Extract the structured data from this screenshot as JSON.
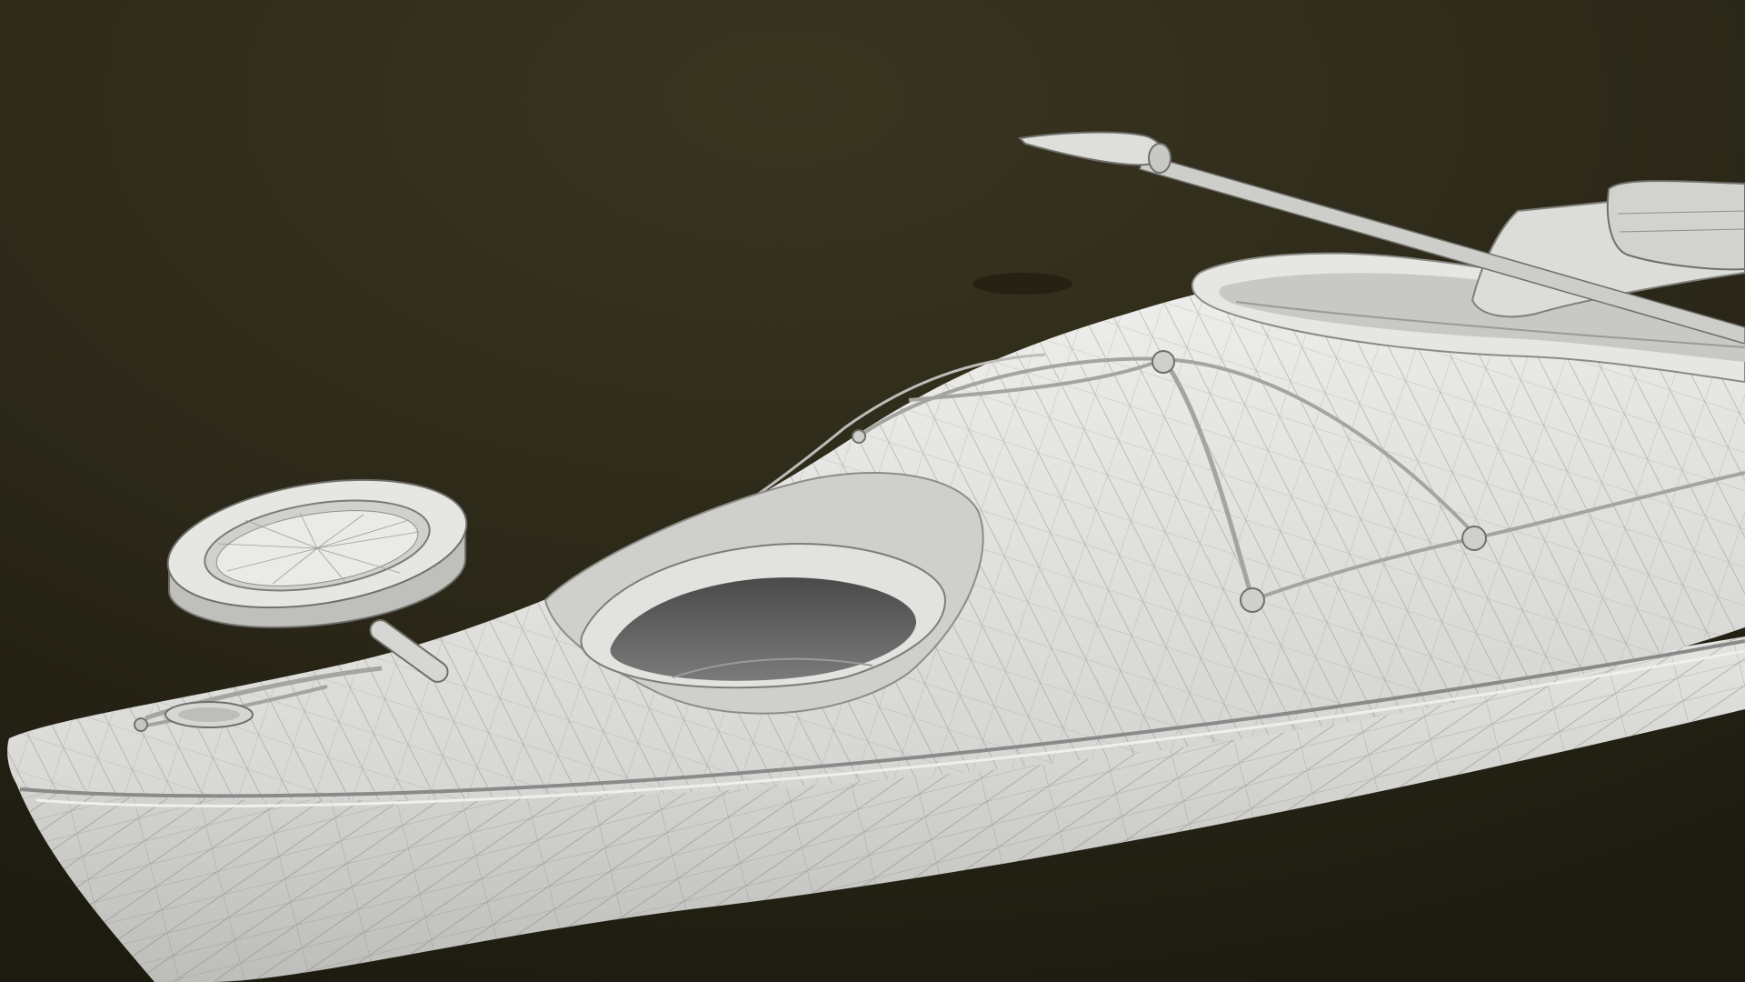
{
  "scene": {
    "subject": "kayak-wireframe-render",
    "colors": {
      "background_top": "#3a3521",
      "background_bottom": "#1d1b10",
      "hull_light": "#f1f1ef",
      "hull_mid": "#d9d9d6",
      "hull_shadow": "#a9a9a6",
      "cockpit_dark": "#5a5a5a",
      "wireframe": "#6e6e6e",
      "bungee": "#c9c9c6"
    },
    "objects": [
      {
        "name": "kayak-hull",
        "icon": "kayak-icon"
      },
      {
        "name": "paddle",
        "icon": "paddle-icon"
      },
      {
        "name": "hatch-cover",
        "icon": "hatch-lid-icon"
      }
    ]
  }
}
